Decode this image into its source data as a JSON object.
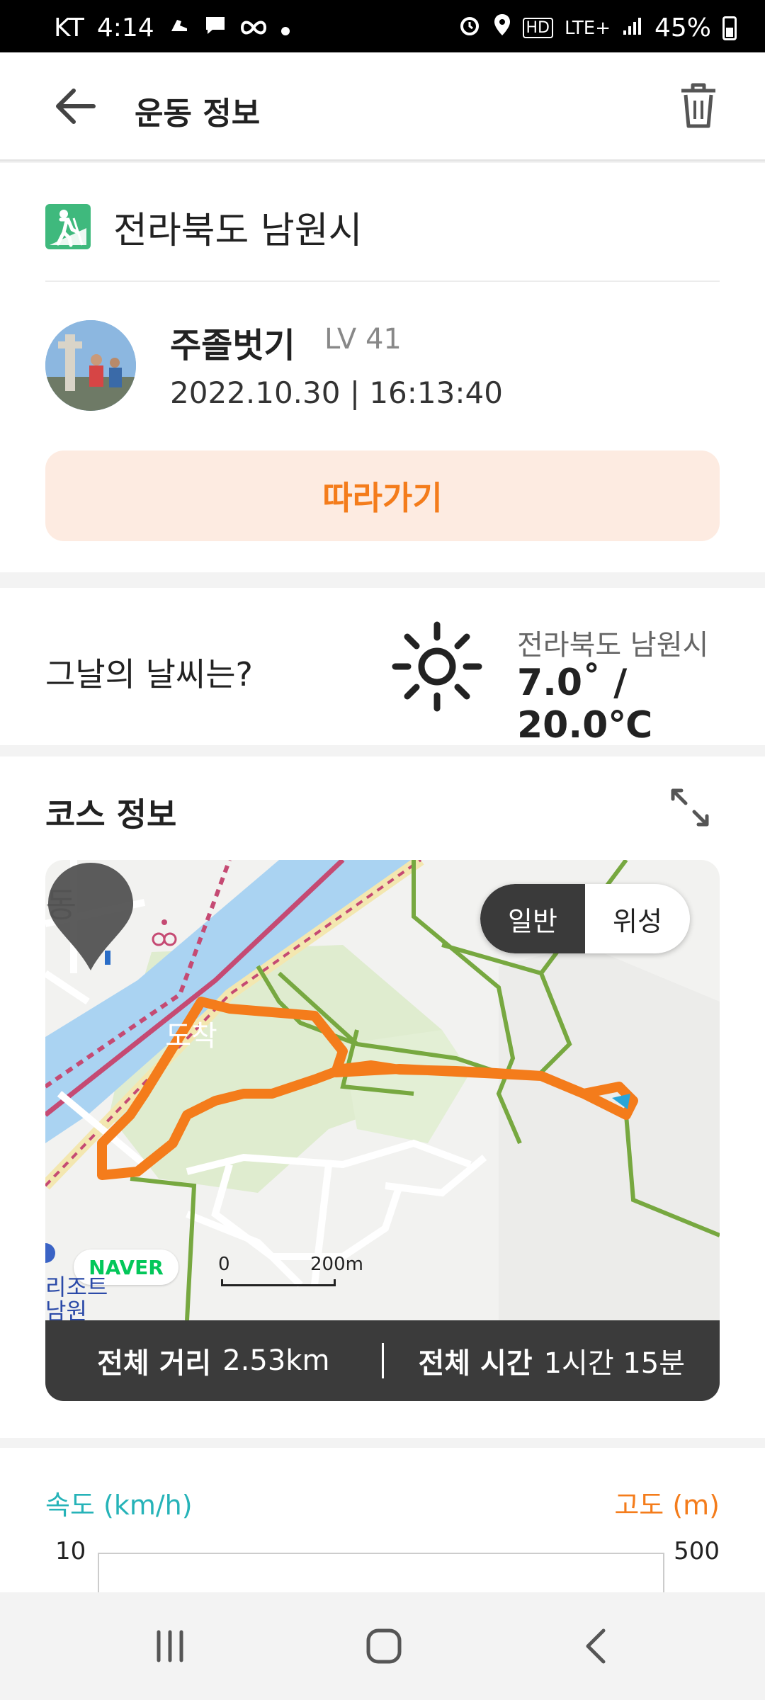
{
  "status_bar": {
    "carrier": "KT",
    "time": "4:14",
    "network": "LTE+",
    "battery": "45%",
    "hd_label": "HD"
  },
  "header": {
    "title": "운동 정보",
    "back_icon": "arrow-left-icon",
    "delete_icon": "trash-icon"
  },
  "activity": {
    "region": "전라북도 남원시",
    "activity_icon": "hiking-icon",
    "user_name": "주졸벗기",
    "level": "LV 41",
    "datetime": "2022.10.30 | 16:13:40",
    "follow_label": "따라가기"
  },
  "weather": {
    "question": "그날의 날씨는?",
    "location": "전라북도 남원시",
    "temperature": "7.0˚ / 20.0℃",
    "icon": "sun-icon"
  },
  "course": {
    "title": "코스 정보",
    "map_mode_general": "일반",
    "map_mode_satellite": "위성",
    "arrival_label": "도착",
    "provider": "NAVER",
    "scale_zero": "0",
    "scale_distance": "200m",
    "map_place_text": "리조트\n남원",
    "distance_label": "전체 거리",
    "distance_value": "2.53km",
    "time_label": "전체 시간",
    "time_value": "1시간 15분"
  },
  "chart_data": {
    "type": "line",
    "series": [
      {
        "name": "속도 (km/h)",
        "values": []
      },
      {
        "name": "고도 (m)",
        "values": []
      }
    ],
    "y_left_label": "속도 (km/h)",
    "y_right_label": "고도 (m)",
    "y_left_max_tick": "10",
    "y_right_max_tick": "500",
    "colors": {
      "speed": "#26b3b8",
      "altitude": "#f47c1b"
    }
  },
  "colors": {
    "accent": "#f47c1b",
    "follow_bg": "#fdebe1",
    "hiking_green": "#3fb97d",
    "speed_teal": "#26b3b8"
  }
}
